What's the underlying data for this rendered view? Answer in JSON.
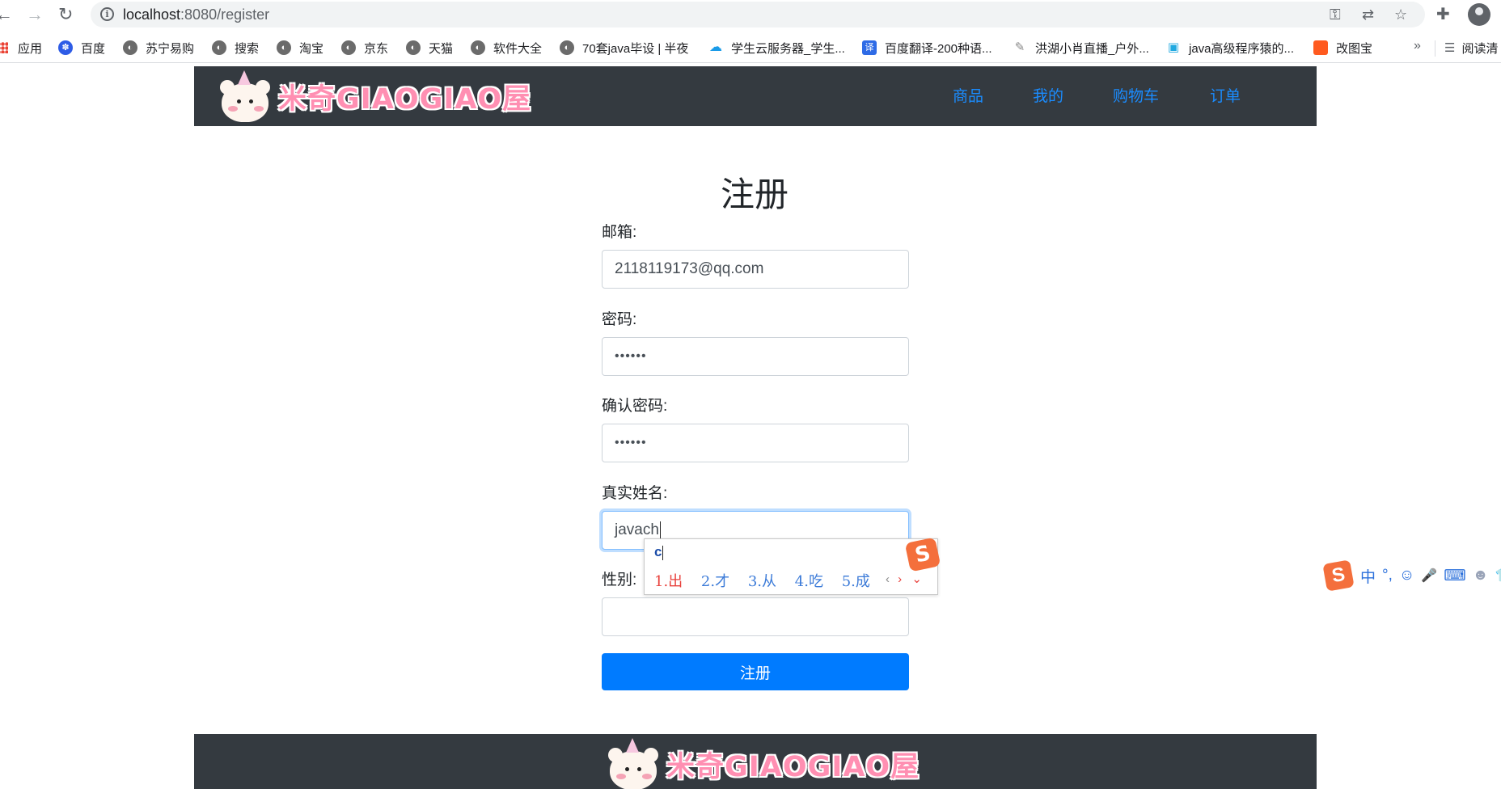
{
  "browser": {
    "back_glyph": "←",
    "forward_glyph": "→",
    "reload_glyph": "↻",
    "info_glyph": "i",
    "url_host": "localhost",
    "url_rest": ":8080/register",
    "key_glyph": "⚿",
    "translate_glyph": "⇄",
    "star_glyph": "☆",
    "puzzle_glyph": "✚"
  },
  "bookmarks": {
    "items": [
      {
        "label": "应用",
        "icon": "apps-grid-icon"
      },
      {
        "label": "百度",
        "icon": "baidu-paw-icon",
        "glyph": "✽"
      },
      {
        "label": "苏宁易购",
        "icon": "globe-icon",
        "glyph": "◐"
      },
      {
        "label": "搜索",
        "icon": "globe-icon",
        "glyph": "◐"
      },
      {
        "label": "淘宝",
        "icon": "globe-icon",
        "glyph": "◐"
      },
      {
        "label": "京东",
        "icon": "globe-icon",
        "glyph": "◐"
      },
      {
        "label": "天猫",
        "icon": "globe-icon",
        "glyph": "◐"
      },
      {
        "label": "软件大全",
        "icon": "globe-icon",
        "glyph": "◐"
      },
      {
        "label": "70套java毕设 | 半夜",
        "icon": "globe-icon",
        "glyph": "◐"
      },
      {
        "label": "学生云服务器_学生...",
        "icon": "cloud-icon",
        "glyph": "☁"
      },
      {
        "label": "百度翻译-200种语...",
        "icon": "translate-icon",
        "glyph": "译"
      },
      {
        "label": "洪湖小肖直播_户外...",
        "icon": "pen-icon",
        "glyph": "✎"
      },
      {
        "label": "java高级程序猿的...",
        "icon": "bilibili-icon",
        "glyph": "▣"
      },
      {
        "label": "改图宝",
        "icon": "orange-app-icon",
        "glyph": "■"
      }
    ],
    "more_glyph": "»",
    "reading_list_glyph": "☰",
    "reading_list_label": "阅读清"
  },
  "header": {
    "logo_text": "米奇GIAOGIAO屋",
    "nav": [
      "商品",
      "我的",
      "购物车",
      "订单"
    ]
  },
  "form": {
    "title": "注册",
    "email_label": "邮箱:",
    "email_value": "2118119173@qq.com",
    "password_label": "密码:",
    "password_value": "••••••",
    "confirm_label": "确认密码:",
    "confirm_value": "••••••",
    "realname_label": "真实姓名:",
    "realname_value": "javach",
    "gender_label": "性别:",
    "gender_value": "",
    "submit_label": "注册"
  },
  "ime": {
    "pinyin": "c",
    "candidates": [
      "1.出",
      "2.才",
      "3.从",
      "4.吃",
      "5.成"
    ],
    "prev_glyph": "‹",
    "next_glyph": "›",
    "expand_glyph": "⌄",
    "logo_glyph": "S"
  },
  "ime_bar": {
    "logo_glyph": "S",
    "mode": "中",
    "punct": "°,",
    "emoji_glyph": "☺",
    "mic_glyph": "🎤",
    "keyboard_glyph": "⌨",
    "user_glyph": "☻",
    "skin_glyph": "👕"
  },
  "footer": {
    "logo_text": "米奇GIAOGIAO屋"
  },
  "colors": {
    "header_bg": "#343a40",
    "link_blue": "#1a8cff",
    "primary": "#007bff",
    "logo_pink": "#ff8fb2",
    "ime_orange": "#f46f3c"
  }
}
